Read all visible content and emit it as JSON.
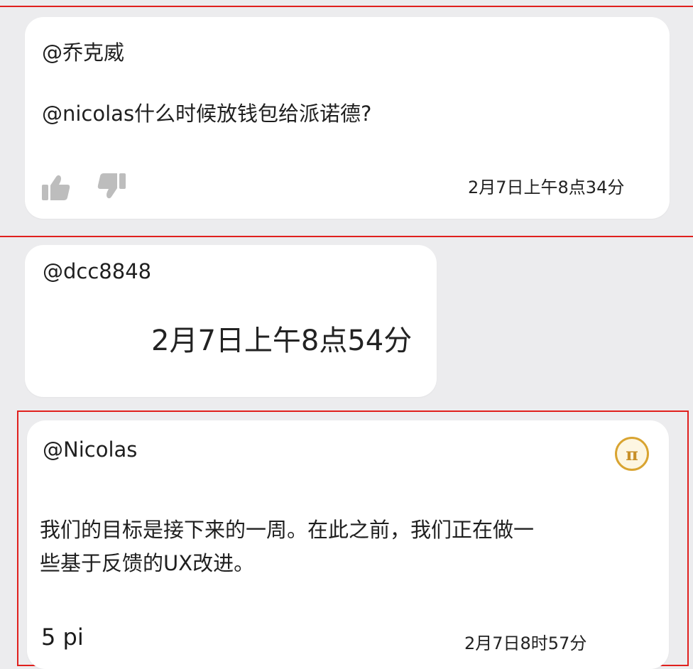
{
  "comments": [
    {
      "author": "@乔克威",
      "body_lines": [
        "@nicolas什么时候放钱包给派诺德?"
      ],
      "timestamp": "2月7日上午8点34分",
      "icons": [
        "thumbs-up-icon",
        "thumbs-down-icon"
      ]
    },
    {
      "author": "@dcc8848",
      "body_lines": [
        "2月7日上午8点54分"
      ]
    },
    {
      "author": "@Nicolas",
      "body_lines": [
        "我们的目标是接下来的一周。在此之前，我们正在做一",
        "些基于反馈的UX改进。"
      ],
      "tip": "5 pi",
      "timestamp": "2月7日8时57分",
      "badge_icon": "pi-network-icon",
      "badge_glyph": "π"
    }
  ],
  "colors": {
    "highlight_border": "#e0201d",
    "background": "#ececee",
    "card": "#ffffff",
    "pi_gold": "#d9a431"
  }
}
